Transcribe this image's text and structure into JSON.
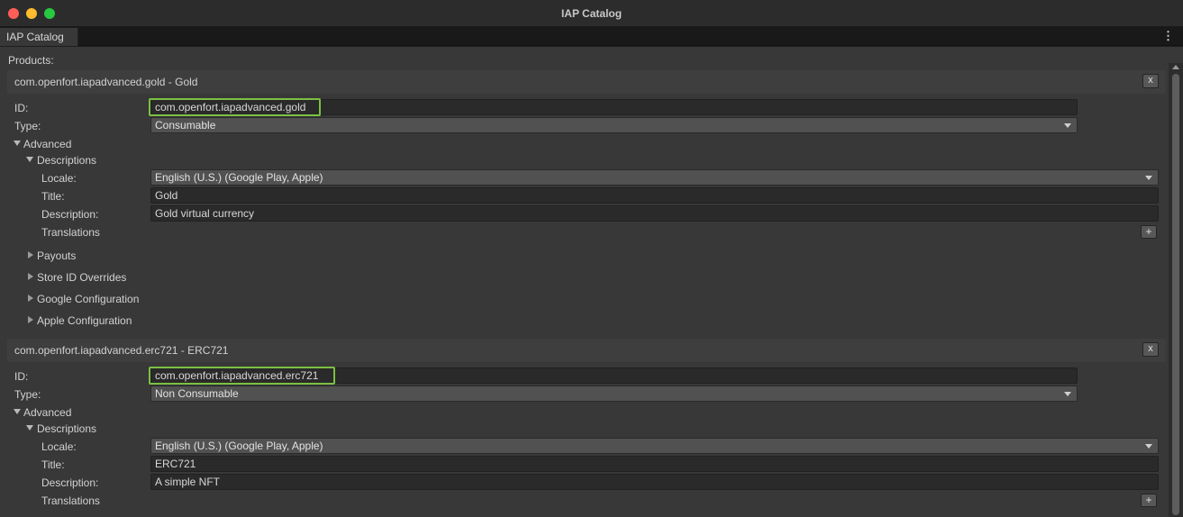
{
  "window": {
    "title": "IAP Catalog"
  },
  "tab": {
    "label": "IAP Catalog",
    "menu_icon": "kebab-menu-icon"
  },
  "products_label": "Products:",
  "labels": {
    "id": "ID:",
    "type": "Type:",
    "advanced": "Advanced",
    "descriptions": "Descriptions",
    "locale": "Locale:",
    "title": "Title:",
    "description": "Description:",
    "translations": "Translations",
    "payouts": "Payouts",
    "store_id_overrides": "Store ID Overrides",
    "google_configuration": "Google Configuration",
    "apple_configuration": "Apple Configuration",
    "remove": "x",
    "add": "+"
  },
  "products": [
    {
      "header": "com.openfort.iapadvanced.gold - Gold",
      "id": "com.openfort.iapadvanced.gold",
      "type": "Consumable",
      "locale": "English (U.S.) (Google Play, Apple)",
      "title": "Gold",
      "description": "Gold virtual currency"
    },
    {
      "header": "com.openfort.iapadvanced.erc721 - ERC721",
      "id": "com.openfort.iapadvanced.erc721",
      "type": "Non Consumable",
      "locale": "English (U.S.) (Google Play, Apple)",
      "title": "ERC721",
      "description": "A simple NFT"
    }
  ],
  "colors": {
    "focus_outline": "#7bc043",
    "panel_bg": "#383838",
    "field_bg": "#2a2a2a"
  }
}
